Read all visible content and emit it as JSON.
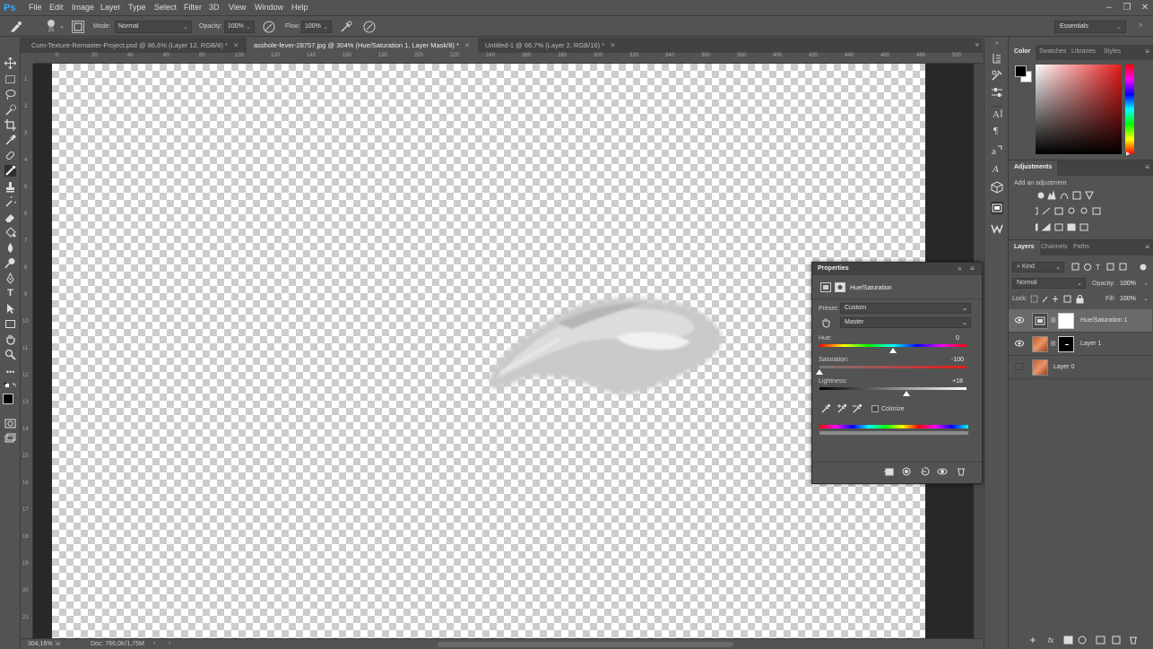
{
  "app": {
    "logo": "Ps"
  },
  "menu": [
    "File",
    "Edit",
    "Image",
    "Layer",
    "Type",
    "Select",
    "Filter",
    "3D",
    "View",
    "Window",
    "Help"
  ],
  "options": {
    "brush_size": "25",
    "mode_label": "Mode:",
    "mode_value": "Normal",
    "opacity_label": "Opacity:",
    "opacity_value": "100%",
    "flow_label": "Flow:",
    "flow_value": "100%",
    "workspace": "Essentials"
  },
  "tabs": [
    {
      "label": "Cum-Texture-Remaster-Project.psd @ 86,6% (Layer 12, RGB/8) *",
      "active": false
    },
    {
      "label": "asshole-fever-28757.jpg @ 304% (Hue/Saturation 1, Layer Mask/8) *",
      "active": true
    },
    {
      "label": "Untitled-1 @ 66,7% (Layer 2, RGB/16) *",
      "active": false
    }
  ],
  "ruler_h": [
    "0",
    "20",
    "40",
    "60",
    "80",
    "100",
    "120",
    "140",
    "160",
    "180",
    "200",
    "220",
    "240",
    "260",
    "280",
    "300",
    "320",
    "340",
    "360",
    "380",
    "400",
    "420",
    "440",
    "460",
    "480",
    "500"
  ],
  "ruler_v": [
    "1",
    "2",
    "3",
    "4",
    "5",
    "6",
    "7",
    "8",
    "9",
    "10",
    "11",
    "12",
    "13",
    "14",
    "15",
    "16",
    "17",
    "18",
    "19",
    "20",
    "21"
  ],
  "status": {
    "zoom": "304,16%",
    "doc": "Doc: 766,0K/1,75M"
  },
  "color_panel": {
    "tabs": [
      "Color",
      "Swatches",
      "Libraries",
      "Styles"
    ],
    "active": 0
  },
  "adjustments": {
    "title": "Adjustments",
    "subtitle": "Add an adjustment"
  },
  "layers_panel": {
    "tabs": [
      "Layers",
      "Channels",
      "Paths"
    ],
    "kind": "Kind",
    "blend": "Normal",
    "opacity_label": "Opacity:",
    "opacity": "100%",
    "lock_label": "Lock:",
    "fill_label": "Fill:",
    "fill": "100%",
    "layers": [
      {
        "name": "Hue/Saturation 1",
        "visible": true,
        "selected": true
      },
      {
        "name": "Layer 1",
        "visible": true,
        "selected": false
      },
      {
        "name": "Layer 0",
        "visible": false,
        "selected": false
      }
    ]
  },
  "properties": {
    "title": "Properties",
    "adj_name": "Hue/Saturation",
    "preset_label": "Preset:",
    "preset": "Custom",
    "channel": "Master",
    "hue_label": "Hue:",
    "hue": "0",
    "sat_label": "Saturation:",
    "sat": "-100",
    "light_label": "Lightness:",
    "light": "+18",
    "colorize_label": "Colorize",
    "hue_level": 0.5,
    "sat_level": 0.0,
    "light_level": 0.59
  },
  "colors": {
    "accent": "#31a8ff",
    "panel": "#535353",
    "dark": "#424242",
    "canvas_bg": "#282828"
  }
}
